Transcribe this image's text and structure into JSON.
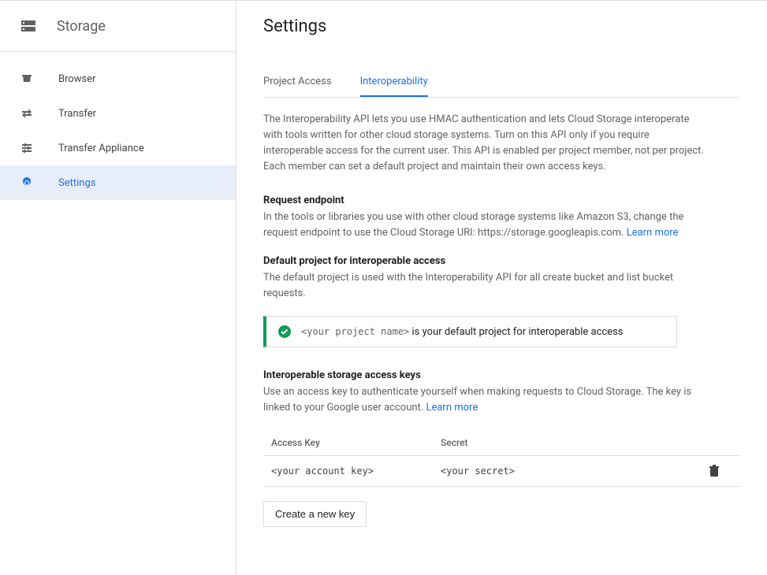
{
  "sidebar": {
    "title": "Storage",
    "items": [
      {
        "label": "Browser"
      },
      {
        "label": "Transfer"
      },
      {
        "label": "Transfer Appliance"
      },
      {
        "label": "Settings"
      }
    ]
  },
  "page": {
    "title": "Settings",
    "tabs": [
      {
        "label": "Project Access"
      },
      {
        "label": "Interoperability"
      }
    ],
    "description": "The Interoperability API lets you use HMAC authentication and lets Cloud Storage interoperate with tools written for other cloud storage systems. Turn on this API only if you require interoperable access for the current user. This API is enabled per project member, not per project. Each member can set a default project and maintain their own access keys.",
    "request_endpoint": {
      "heading": "Request endpoint",
      "text_prefix": "In the tools or libraries you use with other cloud storage systems like Amazon S3, change the request endpoint to use the Cloud Storage URI: https://storage.googleapis.com. ",
      "learn_more": "Learn more"
    },
    "default_project": {
      "heading": "Default project for interoperable access",
      "text": "The default project is used with the Interoperability API for all create bucket and list bucket requests.",
      "banner_projectname": "<your project name>",
      "banner_text": " is your default project for interoperable access"
    },
    "access_keys": {
      "heading": "Interoperable storage access keys",
      "text_prefix": "Use an access key to authenticate yourself when making requests to Cloud Storage. The key is linked to your Google user account. ",
      "learn_more": "Learn more",
      "columns": {
        "key": "Access Key",
        "secret": "Secret"
      },
      "rows": [
        {
          "key": "<your account key>",
          "secret": "<your secret>"
        }
      ],
      "create_button": "Create a new key"
    }
  }
}
